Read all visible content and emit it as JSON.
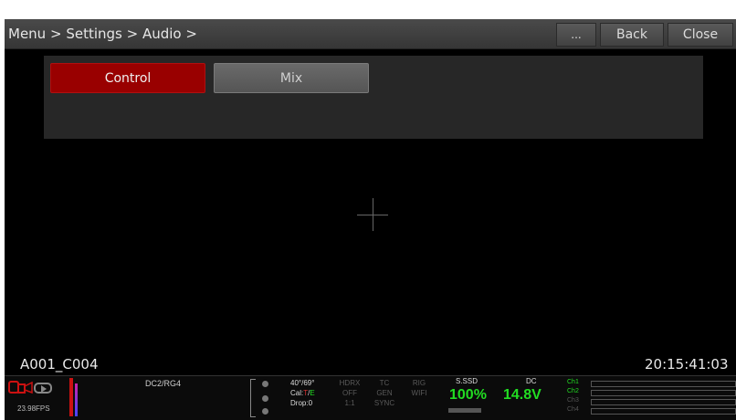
{
  "header": {
    "breadcrumb": [
      "Menu",
      "Settings",
      "Audio"
    ],
    "separator": ">",
    "more_label": "...",
    "back_label": "Back",
    "close_label": "Close"
  },
  "tabs": [
    {
      "label": "Control",
      "active": true
    },
    {
      "label": "Mix",
      "active": false
    }
  ],
  "overlay": {
    "clip_name": "A001_C004",
    "timecode": "20:15:41:03"
  },
  "status": {
    "fps": "23.98FPS",
    "codec": "DC2/RG4",
    "temp": "40°/69°",
    "cal_prefix": "Cal:",
    "cal_t": "T",
    "cal_sep": "/",
    "cal_e": "E",
    "drop": "Drop:0",
    "hdrx_label": "HDRX",
    "hdrx_value": "OFF",
    "hdrx_ratio": "1:1",
    "tc_label": "TC",
    "tc_value": "GEN",
    "tc_sync": "SYNC",
    "rig_label": "RIG",
    "rig_value": "WIFI",
    "media_label": "S.SSD",
    "media_pct": "100%",
    "power_label": "DC",
    "power_volt": "14.8V",
    "channels": [
      "Ch1",
      "Ch2",
      "Ch3",
      "Ch4"
    ]
  },
  "colors": {
    "accent_red": "#990000",
    "status_green": "#22dd22"
  }
}
